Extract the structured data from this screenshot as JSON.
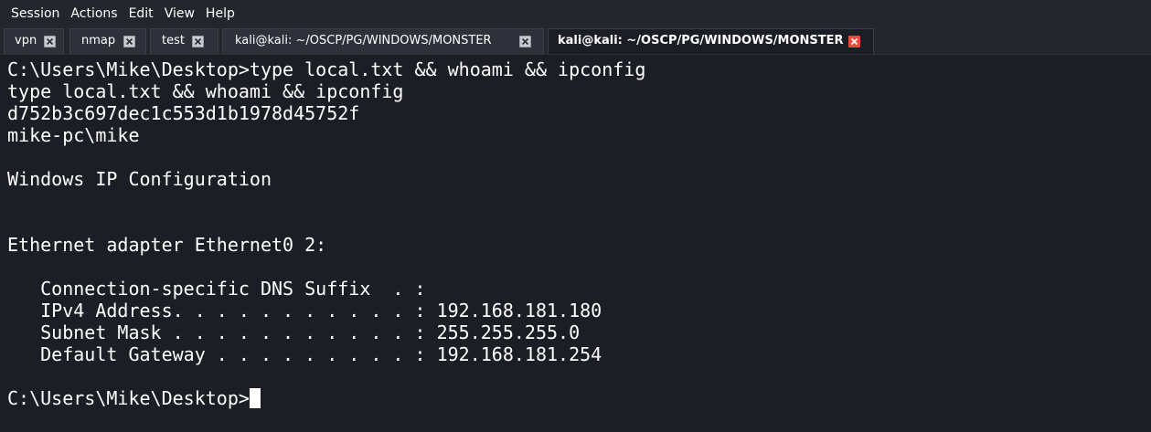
{
  "menu": [
    "Session",
    "Actions",
    "Edit",
    "View",
    "Help"
  ],
  "tabs": [
    {
      "label": "vpn",
      "active": false
    },
    {
      "label": "nmap",
      "active": false
    },
    {
      "label": "test",
      "active": false
    },
    {
      "label": "kali@kali: ~/OSCP/PG/WINDOWS/MONSTER",
      "active": false
    },
    {
      "label": "kali@kali: ~/OSCP/PG/WINDOWS/MONSTER",
      "active": true
    }
  ],
  "terminal": {
    "lines": [
      "C:\\Users\\Mike\\Desktop>type local.txt && whoami && ipconfig",
      "type local.txt && whoami && ipconfig",
      "d752b3c697dec1c553d1b1978d45752f",
      "mike-pc\\mike",
      "",
      "Windows IP Configuration",
      "",
      "",
      "Ethernet adapter Ethernet0 2:",
      "",
      "   Connection-specific DNS Suffix  . :",
      "   IPv4 Address. . . . . . . . . . . : 192.168.181.180",
      "   Subnet Mask . . . . . . . . . . . : 255.255.255.0",
      "   Default Gateway . . . . . . . . . : 192.168.181.254",
      "",
      "C:\\Users\\Mike\\Desktop>"
    ]
  },
  "colors": {
    "background": "#1c1e26",
    "text": "#ffffff",
    "active_close": "#e74c3c"
  }
}
